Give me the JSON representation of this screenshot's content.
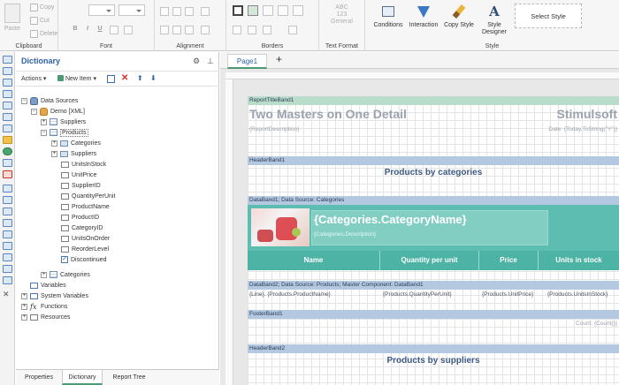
{
  "ribbon": {
    "clipboard": {
      "paste": "Paste",
      "copy": "Copy",
      "cut": "Cut",
      "delete": "Delete",
      "label": "Clipboard"
    },
    "font": {
      "label": "Font",
      "bold": "B",
      "italic": "I",
      "underline": "U"
    },
    "alignment": {
      "label": "Alignment"
    },
    "borders": {
      "label": "Borders"
    },
    "text_format": {
      "label": "Text Format",
      "abc": "ABC",
      "num": "123",
      "general": "General"
    },
    "style": {
      "label": "Style",
      "conditions": "Conditions",
      "interaction": "Interaction",
      "copy_style": "Copy Style",
      "style_designer_1": "Style",
      "style_designer_2": "Designer",
      "select_style": "Select Style"
    }
  },
  "dictionary": {
    "title": "Dictionary",
    "actions": "Actions",
    "new_item": "New Item",
    "tree": {
      "data_sources": "Data Sources",
      "demo": "Demo [XML]",
      "suppliers": "Suppliers",
      "products": "Products",
      "categories_rel": "Categories",
      "suppliers_rel": "Suppliers",
      "fields": [
        "UnitsInStock",
        "UnitPrice",
        "SupplierID",
        "QuantityPerUnit",
        "ProductName",
        "ProductID",
        "CategoryID",
        "UnitsOnOrder",
        "ReorderLevel",
        "Discontinued"
      ],
      "categories": "Categories",
      "variables": "Variables",
      "system_variables": "System Variables",
      "functions": "Functions",
      "resources": "Resources"
    },
    "bottom_tabs": [
      "Properties",
      "Dictionary",
      "Report Tree"
    ]
  },
  "page": {
    "tab": "Page1",
    "add": "+",
    "report_title_band": "ReportTitleBand1",
    "report_title_left": "Two Masters on One Detail",
    "report_title_right": "Stimulsoft",
    "report_description": "{ReportDescription}",
    "date_expr": "Date: {Today.ToString(\"Y\")}",
    "header_band_1": "HeaderBand1",
    "products_by_categories": "Products by categories",
    "data_band_1": "DataBand1; Data Source: Categories",
    "category_name": "{Categories.CategoryName}",
    "category_description": "{Categories.Description}",
    "columns": [
      "Name",
      "Quantity per unit",
      "Price",
      "Units in stock"
    ],
    "data_band_2": "DataBand2; Data Source: Products; Master Component: DataBand1",
    "data_cells": [
      "{Line}. {Products.ProductName}",
      "{Products.QuantityPerUnit}",
      "{Products.UnitPrice}",
      "{Products.UnitsInStock}"
    ],
    "footer_band_1": "FooterBand1",
    "count_expr": "Count: {Count()}",
    "header_band_2": "HeaderBand2",
    "products_by_suppliers": "Products by suppliers"
  }
}
